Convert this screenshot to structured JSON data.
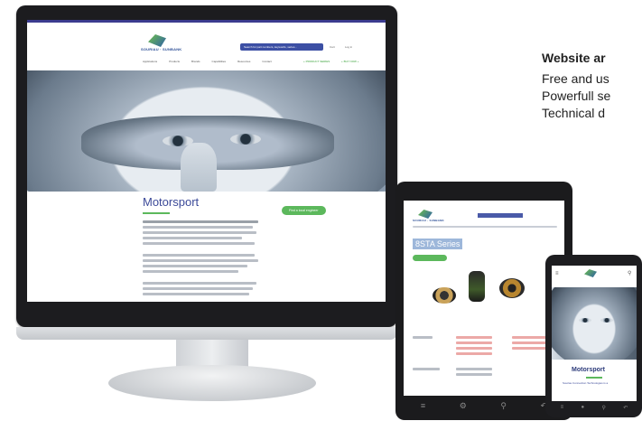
{
  "right_text": {
    "heading": "Website ar",
    "line1": "Free and us",
    "line2": "Powerfull se",
    "line3": "Technical d"
  },
  "monitor_site": {
    "logo": "SOURIAU · SUNBANK",
    "search": "Search for part numbers, keywords, series...",
    "cart": "Cart",
    "login": "Log in",
    "nav": [
      "Applications",
      "Products",
      "Brands",
      "Capabilities",
      "Resources",
      "Contact"
    ],
    "nav_green": [
      "+ PRODUCT SERIES",
      "+ BUY NOW +"
    ],
    "page_title": "Motorsport",
    "cta": "Find a local engineer"
  },
  "tablet_site": {
    "series_title": "8STA Series",
    "icons": [
      "menu-icon",
      "settings-icon",
      "search-icon",
      "back-icon"
    ]
  },
  "phone_site": {
    "page_title": "Motorsport",
    "footer_text": "Souriau Connection Technologies is a"
  },
  "colors": {
    "brand": "#3c4a99",
    "accent_green": "#5cb85c",
    "device_bezel": "#1c1c1f"
  }
}
